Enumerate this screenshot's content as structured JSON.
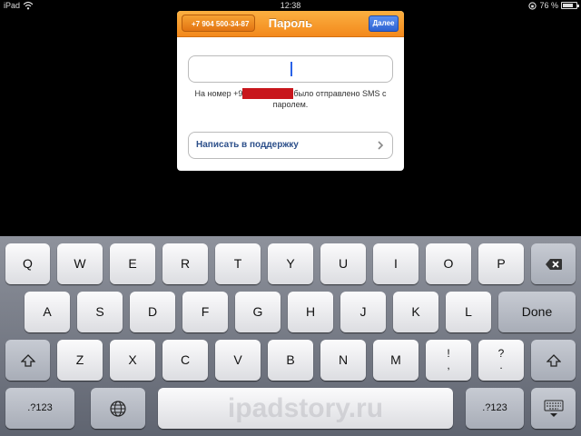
{
  "status_bar": {
    "carrier": "iPad",
    "time": "12:38",
    "battery": "76 %",
    "battery_level": 0.76
  },
  "dialog": {
    "back_label": "+7 904 500-34-87",
    "title": "Пароль",
    "done_label": "Далее",
    "password_value": "",
    "info_prefix": "На номер +9",
    "info_suffix": "было отправлено SMS с паролем.",
    "support_label": "Написать в поддержку"
  },
  "keyboard": {
    "row1": [
      "Q",
      "W",
      "E",
      "R",
      "T",
      "Y",
      "U",
      "I",
      "O",
      "P"
    ],
    "row2": [
      "A",
      "S",
      "D",
      "F",
      "G",
      "H",
      "J",
      "K",
      "L"
    ],
    "row3": [
      "Z",
      "X",
      "C",
      "V",
      "B",
      "N",
      "M"
    ],
    "done_label": "Done",
    "punct1_top": "!",
    "punct1_bottom": ",",
    "punct2_top": "?",
    "punct2_bottom": ".",
    "numbers_label": ".?123",
    "watermark": "ipadstory.ru"
  }
}
